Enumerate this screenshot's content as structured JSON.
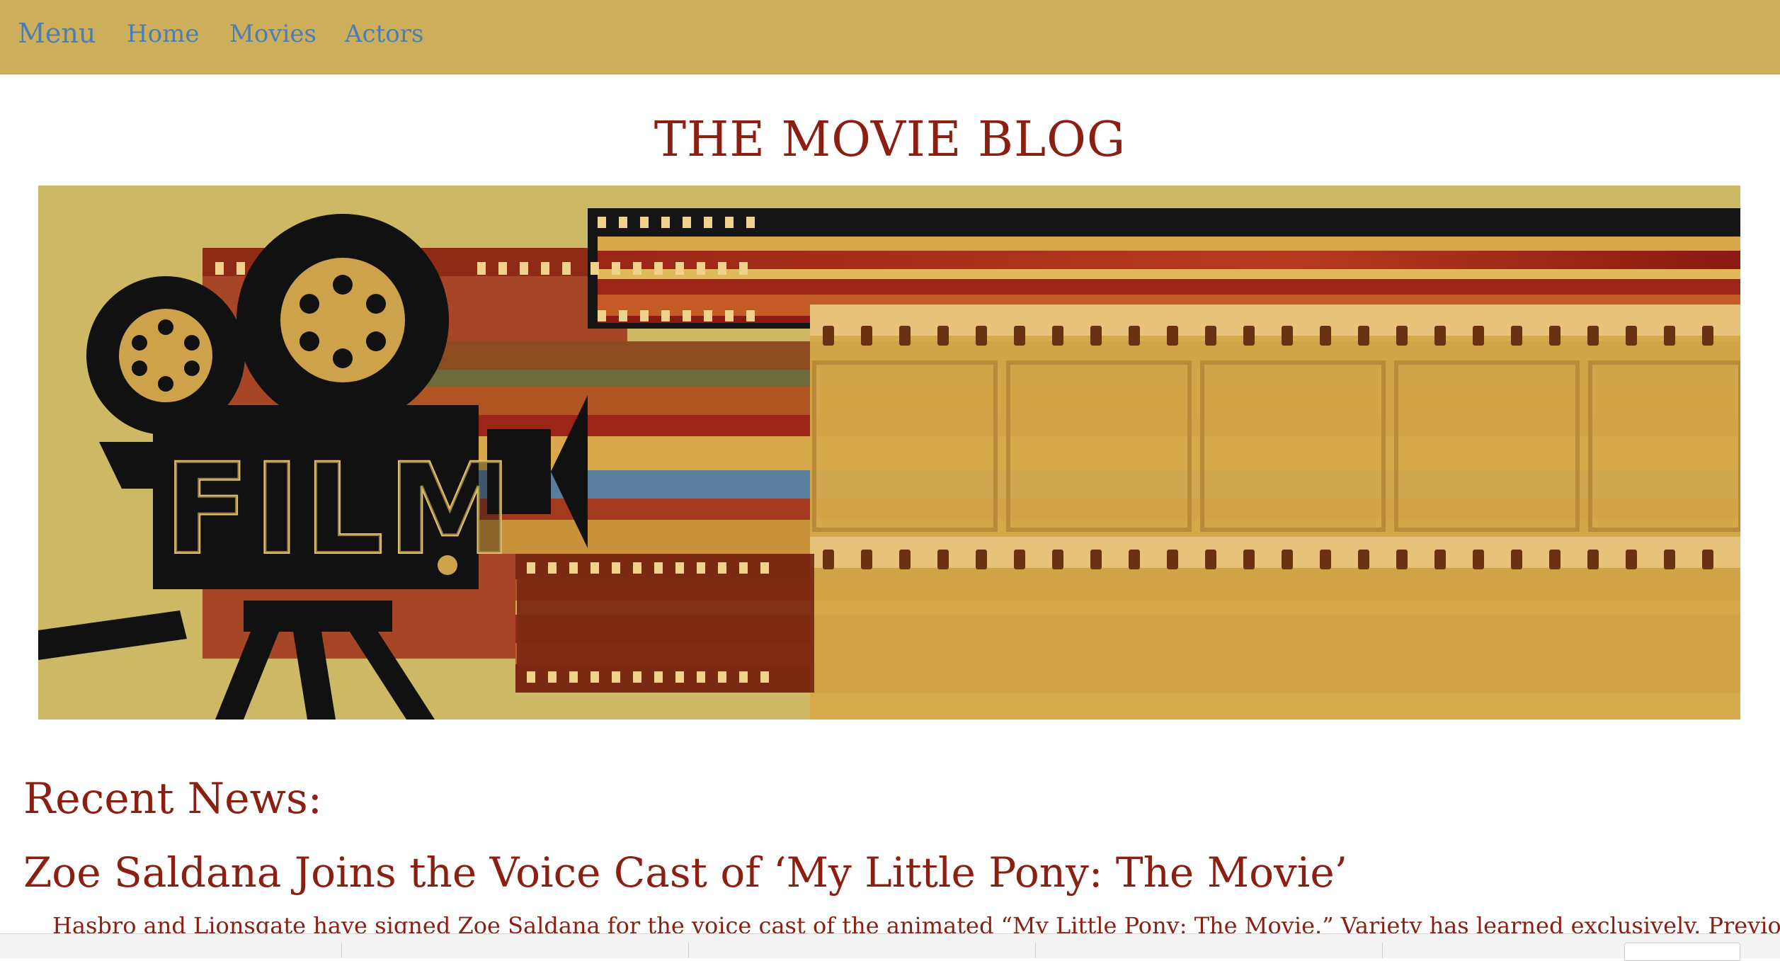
{
  "nav": {
    "menu_label": "Menu",
    "items": [
      {
        "label": "Home"
      },
      {
        "label": "Movies"
      },
      {
        "label": "Actors"
      }
    ]
  },
  "header": {
    "site_title": "THE MOVIE BLOG"
  },
  "banner": {
    "image_name": "film-camera-banner",
    "logo_text": "FILM",
    "colors": {
      "background": "#cdb865",
      "dark": "#111111",
      "red": "#9b2516",
      "gold": "#d7a94a",
      "blue": "#5b7d9c"
    }
  },
  "main": {
    "section_heading": "Recent News:",
    "articles": [
      {
        "title": "Zoe Saldana Joins the Voice Cast of ‘My Little Pony: The Movie’",
        "excerpt": "Hasbro and Lionsgate have signed Zoe Saldana for the voice cast of the animated “My Little Pony: The Movie.” Variety has learned exclusively. Previously announced"
      }
    ]
  },
  "theme": {
    "navbar_bg": "#ccae5b",
    "link_color": "#4a7fb5",
    "title_color": "#8a1f12"
  }
}
